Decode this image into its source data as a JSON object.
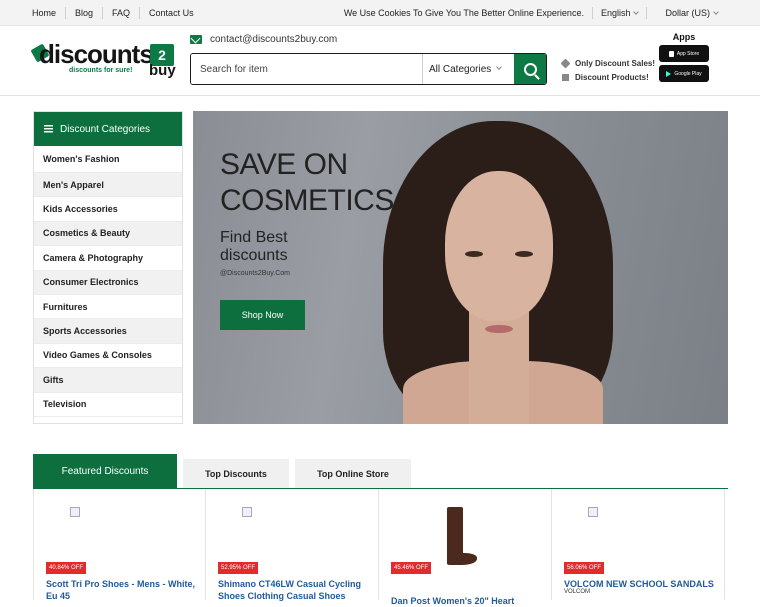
{
  "topbar": {
    "nav": [
      "Home",
      "Blog",
      "FAQ",
      "Contact Us"
    ],
    "cookie_text": "We Use Cookies To Give You The Better Online Experience.",
    "language": "English",
    "currency": "Dollar (US)"
  },
  "header": {
    "logo_word": "discounts",
    "logo_number": "2",
    "logo_buy": "buy",
    "logo_slogan": "discounts for sure!",
    "contact": "contact@discounts2buy.com",
    "search_placeholder": "Search for item",
    "category_select": "All Categories",
    "promo1": "Only Discount Sales!",
    "promo2": "Discount Products!",
    "apps_title": "Apps",
    "app_store": "App Store",
    "google_play": "Google Play"
  },
  "sidebar": {
    "title": "Discount Categories",
    "items": [
      "Women's Fashion",
      "Men's Apparel",
      "Kids Accessories",
      "Cosmetics & Beauty",
      "Camera & Photography",
      "Consumer Electronics",
      "Furnitures",
      "Sports Accessories",
      "Video Games & Consoles",
      "Gifts",
      "Television"
    ]
  },
  "banner": {
    "headline1": "SAVE ON",
    "headline2": "COSMETICS",
    "sub1": "Find Best",
    "sub2": "discounts",
    "handle": "@Discounts2Buy.Com",
    "cta": "Shop Now"
  },
  "tabs": [
    "Featured Discounts",
    "Top Discounts",
    "Top Online Store"
  ],
  "products": [
    {
      "badge": "40.84% OFF",
      "name": "Scott Tri Pro Shoes - Mens - White, Eu 45",
      "brand": ""
    },
    {
      "badge": "52.95% OFF",
      "name": "Shimano CT46LW Casual Cycling Shoes Clothing Casual Shoes",
      "brand": ""
    },
    {
      "badge": "45.46% OFF",
      "name": "Dan Post Women's 20\" Heart",
      "brand": ""
    },
    {
      "badge": "56.06% OFF",
      "name": "VOLCOM NEW SCHOOL SANDALS",
      "brand": "VOLCOM"
    }
  ],
  "colors": {
    "brand_green": "#0d6e3e",
    "discount_red": "#e42b2b",
    "product_link": "#1e5a9c"
  }
}
